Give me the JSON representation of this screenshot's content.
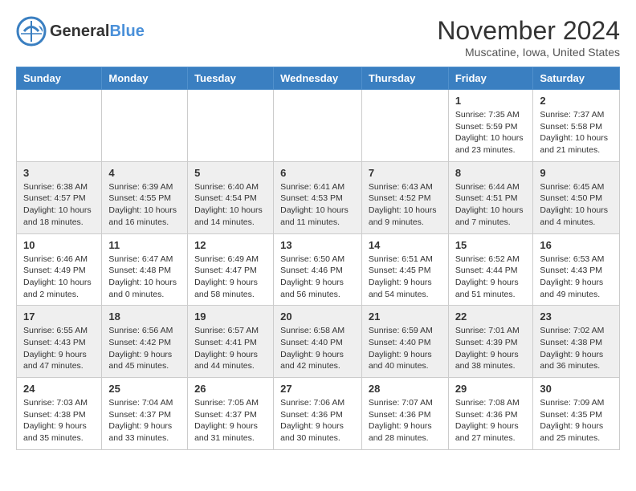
{
  "header": {
    "logo_general": "General",
    "logo_blue": "Blue",
    "month_title": "November 2024",
    "location": "Muscatine, Iowa, United States"
  },
  "calendar": {
    "headers": [
      "Sunday",
      "Monday",
      "Tuesday",
      "Wednesday",
      "Thursday",
      "Friday",
      "Saturday"
    ],
    "rows": [
      [
        {
          "day": "",
          "info": ""
        },
        {
          "day": "",
          "info": ""
        },
        {
          "day": "",
          "info": ""
        },
        {
          "day": "",
          "info": ""
        },
        {
          "day": "",
          "info": ""
        },
        {
          "day": "1",
          "info": "Sunrise: 7:35 AM\nSunset: 5:59 PM\nDaylight: 10 hours\nand 23 minutes."
        },
        {
          "day": "2",
          "info": "Sunrise: 7:37 AM\nSunset: 5:58 PM\nDaylight: 10 hours\nand 21 minutes."
        }
      ],
      [
        {
          "day": "3",
          "info": "Sunrise: 6:38 AM\nSunset: 4:57 PM\nDaylight: 10 hours\nand 18 minutes."
        },
        {
          "day": "4",
          "info": "Sunrise: 6:39 AM\nSunset: 4:55 PM\nDaylight: 10 hours\nand 16 minutes."
        },
        {
          "day": "5",
          "info": "Sunrise: 6:40 AM\nSunset: 4:54 PM\nDaylight: 10 hours\nand 14 minutes."
        },
        {
          "day": "6",
          "info": "Sunrise: 6:41 AM\nSunset: 4:53 PM\nDaylight: 10 hours\nand 11 minutes."
        },
        {
          "day": "7",
          "info": "Sunrise: 6:43 AM\nSunset: 4:52 PM\nDaylight: 10 hours\nand 9 minutes."
        },
        {
          "day": "8",
          "info": "Sunrise: 6:44 AM\nSunset: 4:51 PM\nDaylight: 10 hours\nand 7 minutes."
        },
        {
          "day": "9",
          "info": "Sunrise: 6:45 AM\nSunset: 4:50 PM\nDaylight: 10 hours\nand 4 minutes."
        }
      ],
      [
        {
          "day": "10",
          "info": "Sunrise: 6:46 AM\nSunset: 4:49 PM\nDaylight: 10 hours\nand 2 minutes."
        },
        {
          "day": "11",
          "info": "Sunrise: 6:47 AM\nSunset: 4:48 PM\nDaylight: 10 hours\nand 0 minutes."
        },
        {
          "day": "12",
          "info": "Sunrise: 6:49 AM\nSunset: 4:47 PM\nDaylight: 9 hours\nand 58 minutes."
        },
        {
          "day": "13",
          "info": "Sunrise: 6:50 AM\nSunset: 4:46 PM\nDaylight: 9 hours\nand 56 minutes."
        },
        {
          "day": "14",
          "info": "Sunrise: 6:51 AM\nSunset: 4:45 PM\nDaylight: 9 hours\nand 54 minutes."
        },
        {
          "day": "15",
          "info": "Sunrise: 6:52 AM\nSunset: 4:44 PM\nDaylight: 9 hours\nand 51 minutes."
        },
        {
          "day": "16",
          "info": "Sunrise: 6:53 AM\nSunset: 4:43 PM\nDaylight: 9 hours\nand 49 minutes."
        }
      ],
      [
        {
          "day": "17",
          "info": "Sunrise: 6:55 AM\nSunset: 4:43 PM\nDaylight: 9 hours\nand 47 minutes."
        },
        {
          "day": "18",
          "info": "Sunrise: 6:56 AM\nSunset: 4:42 PM\nDaylight: 9 hours\nand 45 minutes."
        },
        {
          "day": "19",
          "info": "Sunrise: 6:57 AM\nSunset: 4:41 PM\nDaylight: 9 hours\nand 44 minutes."
        },
        {
          "day": "20",
          "info": "Sunrise: 6:58 AM\nSunset: 4:40 PM\nDaylight: 9 hours\nand 42 minutes."
        },
        {
          "day": "21",
          "info": "Sunrise: 6:59 AM\nSunset: 4:40 PM\nDaylight: 9 hours\nand 40 minutes."
        },
        {
          "day": "22",
          "info": "Sunrise: 7:01 AM\nSunset: 4:39 PM\nDaylight: 9 hours\nand 38 minutes."
        },
        {
          "day": "23",
          "info": "Sunrise: 7:02 AM\nSunset: 4:38 PM\nDaylight: 9 hours\nand 36 minutes."
        }
      ],
      [
        {
          "day": "24",
          "info": "Sunrise: 7:03 AM\nSunset: 4:38 PM\nDaylight: 9 hours\nand 35 minutes."
        },
        {
          "day": "25",
          "info": "Sunrise: 7:04 AM\nSunset: 4:37 PM\nDaylight: 9 hours\nand 33 minutes."
        },
        {
          "day": "26",
          "info": "Sunrise: 7:05 AM\nSunset: 4:37 PM\nDaylight: 9 hours\nand 31 minutes."
        },
        {
          "day": "27",
          "info": "Sunrise: 7:06 AM\nSunset: 4:36 PM\nDaylight: 9 hours\nand 30 minutes."
        },
        {
          "day": "28",
          "info": "Sunrise: 7:07 AM\nSunset: 4:36 PM\nDaylight: 9 hours\nand 28 minutes."
        },
        {
          "day": "29",
          "info": "Sunrise: 7:08 AM\nSunset: 4:36 PM\nDaylight: 9 hours\nand 27 minutes."
        },
        {
          "day": "30",
          "info": "Sunrise: 7:09 AM\nSunset: 4:35 PM\nDaylight: 9 hours\nand 25 minutes."
        }
      ]
    ]
  }
}
